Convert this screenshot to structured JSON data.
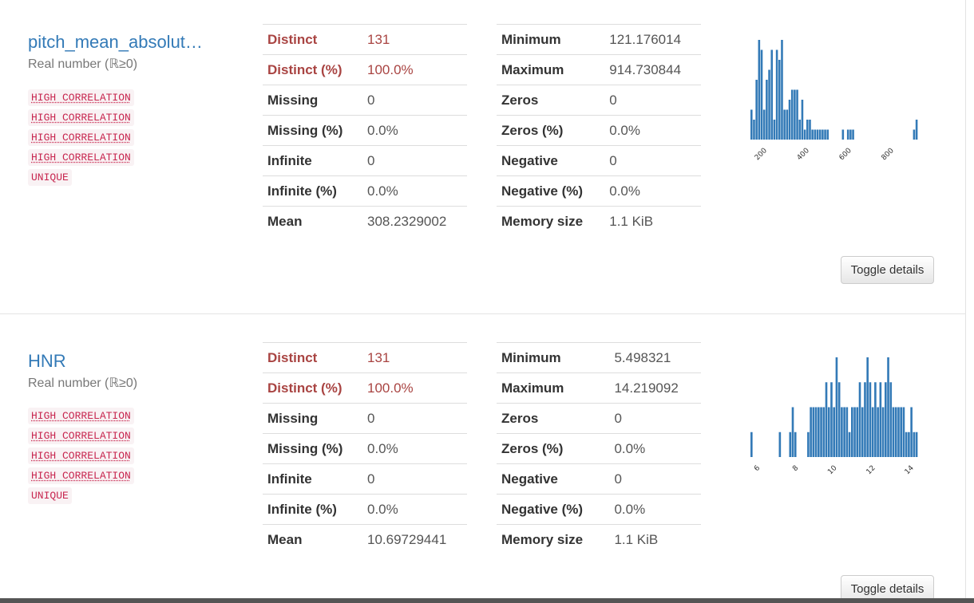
{
  "variables": [
    {
      "name": "pitch_mean_absolut…",
      "type": "Real number (ℝ≥0)",
      "badges": [
        "HIGH CORRELATION",
        "HIGH CORRELATION",
        "HIGH CORRELATION",
        "HIGH CORRELATION",
        "UNIQUE"
      ],
      "stats_left": [
        {
          "label": "Distinct",
          "value": "131"
        },
        {
          "label": "Distinct (%)",
          "value": "100.0%"
        },
        {
          "label": "Missing",
          "value": "0"
        },
        {
          "label": "Missing (%)",
          "value": "0.0%"
        },
        {
          "label": "Infinite",
          "value": "0"
        },
        {
          "label": "Infinite (%)",
          "value": "0.0%"
        },
        {
          "label": "Mean",
          "value": "308.2329002"
        }
      ],
      "stats_right": [
        {
          "label": "Minimum",
          "value": "121.176014"
        },
        {
          "label": "Maximum",
          "value": "914.730844"
        },
        {
          "label": "Zeros",
          "value": "0"
        },
        {
          "label": "Zeros (%)",
          "value": "0.0%"
        },
        {
          "label": "Negative",
          "value": "0"
        },
        {
          "label": "Negative (%)",
          "value": "0.0%"
        },
        {
          "label": "Memory size",
          "value": "1.1 KiB"
        }
      ],
      "toggle_label": "Toggle details",
      "chart_data": {
        "type": "bar",
        "color": "#337ab7",
        "xlim": [
          121.176014,
          914.730844
        ],
        "xticks": [
          "200",
          "400",
          "600",
          "800"
        ],
        "bin_counts": [
          3,
          2,
          6,
          10,
          9,
          3,
          6,
          7,
          9,
          2,
          9,
          8,
          10,
          3,
          3,
          4,
          5,
          5,
          5,
          2,
          4,
          1,
          2,
          2,
          1,
          1,
          1,
          1,
          1,
          1,
          1,
          0,
          0,
          0,
          0,
          0,
          1,
          0,
          1,
          1,
          1,
          0,
          0,
          0,
          0,
          0,
          0,
          0,
          0,
          0,
          0,
          0,
          0,
          0,
          0,
          0,
          0,
          0,
          0,
          0,
          0,
          0,
          0,
          0,
          1,
          2
        ]
      }
    },
    {
      "name": "HNR",
      "type": "Real number (ℝ≥0)",
      "badges": [
        "HIGH CORRELATION",
        "HIGH CORRELATION",
        "HIGH CORRELATION",
        "HIGH CORRELATION",
        "UNIQUE"
      ],
      "stats_left": [
        {
          "label": "Distinct",
          "value": "131"
        },
        {
          "label": "Distinct (%)",
          "value": "100.0%"
        },
        {
          "label": "Missing",
          "value": "0"
        },
        {
          "label": "Missing (%)",
          "value": "0.0%"
        },
        {
          "label": "Infinite",
          "value": "0"
        },
        {
          "label": "Infinite (%)",
          "value": "0.0%"
        },
        {
          "label": "Mean",
          "value": "10.69729441"
        }
      ],
      "stats_right": [
        {
          "label": "Minimum",
          "value": "5.498321"
        },
        {
          "label": "Maximum",
          "value": "14.219092"
        },
        {
          "label": "Zeros",
          "value": "0"
        },
        {
          "label": "Zeros (%)",
          "value": "0.0%"
        },
        {
          "label": "Negative",
          "value": "0"
        },
        {
          "label": "Negative (%)",
          "value": "0.0%"
        },
        {
          "label": "Memory size",
          "value": "1.1 KiB"
        }
      ],
      "toggle_label": "Toggle details",
      "chart_data": {
        "type": "bar",
        "color": "#337ab7",
        "xlim": [
          5.498321,
          14.219092
        ],
        "xticks": [
          "6",
          "8",
          "10",
          "12",
          "14"
        ],
        "bin_counts": [
          1,
          0,
          0,
          0,
          0,
          0,
          0,
          0,
          0,
          0,
          0,
          1,
          0,
          0,
          0,
          1,
          2,
          1,
          0,
          0,
          0,
          0,
          1,
          2,
          2,
          2,
          2,
          2,
          2,
          3,
          2,
          3,
          2,
          4,
          3,
          2,
          2,
          2,
          1,
          2,
          2,
          2,
          3,
          2,
          3,
          4,
          3,
          2,
          3,
          2,
          3,
          2,
          3,
          4,
          3,
          2,
          2,
          2,
          2,
          2,
          1,
          1,
          2,
          1,
          1
        ]
      }
    }
  ]
}
